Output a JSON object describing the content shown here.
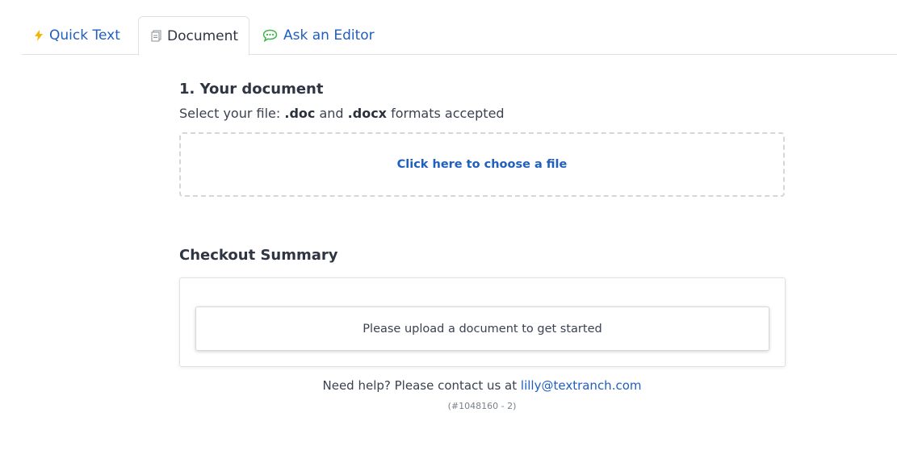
{
  "tabs": {
    "quick_text": "Quick Text",
    "document": "Document",
    "ask_editor": "Ask an Editor"
  },
  "document_section": {
    "title": "1. Your document",
    "hint_prefix": "Select your file:",
    "format_doc": ".doc",
    "hint_and": "and",
    "format_docx": ".docx",
    "hint_suffix": "formats accepted",
    "choose_file": "Click here to choose a file"
  },
  "checkout": {
    "title": "Checkout Summary",
    "message": "Please upload a document to get started"
  },
  "help": {
    "text": "Need help? Please contact us at",
    "email": "lilly@textranch.com",
    "ref": "(#1048160 - 2)"
  },
  "colors": {
    "accent": "#1f5fbf",
    "bolt": "#f2b705",
    "chat": "#3cb54a"
  }
}
